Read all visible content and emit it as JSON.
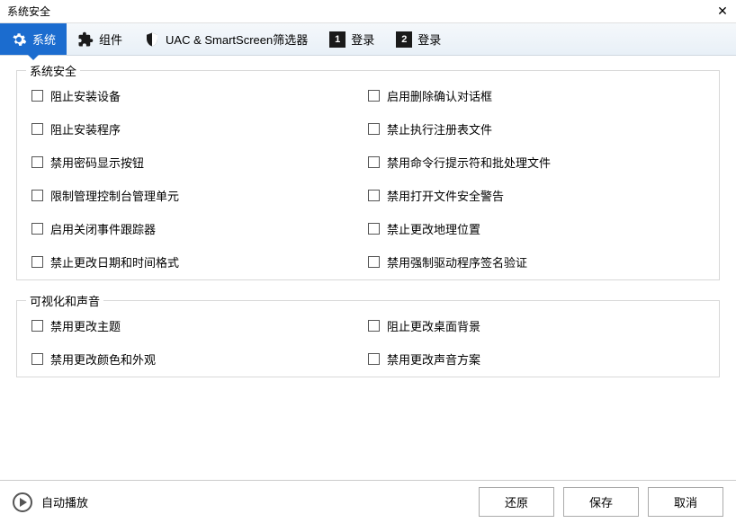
{
  "window": {
    "title": "系统安全"
  },
  "tabs": [
    {
      "icon": "gear",
      "label": "系统",
      "active": true
    },
    {
      "icon": "puzzle",
      "label": "组件"
    },
    {
      "icon": "shield",
      "label": "UAC & SmartScreen筛选器"
    },
    {
      "icon": "num1",
      "label": "登录"
    },
    {
      "icon": "num2",
      "label": "登录"
    }
  ],
  "groups": [
    {
      "label": "系统安全",
      "cols": [
        [
          "阻止安装设备",
          "阻止安装程序",
          "禁用密码显示按钮",
          "限制管理控制台管理单元",
          "启用关闭事件跟踪器",
          "禁止更改日期和时间格式"
        ],
        [
          "启用删除确认对话框",
          "禁止执行注册表文件",
          "禁用命令行提示符和批处理文件",
          "禁用打开文件安全警告",
          "禁止更改地理位置",
          "禁用强制驱动程序签名验证"
        ]
      ]
    },
    {
      "label": "可视化和声音",
      "cols": [
        [
          "禁用更改主题",
          "禁用更改颜色和外观"
        ],
        [
          "阻止更改桌面背景",
          "禁用更改声音方案"
        ]
      ]
    }
  ],
  "footer": {
    "autoplay": "自动播放",
    "restore": "还原",
    "save": "保存",
    "cancel": "取消"
  }
}
